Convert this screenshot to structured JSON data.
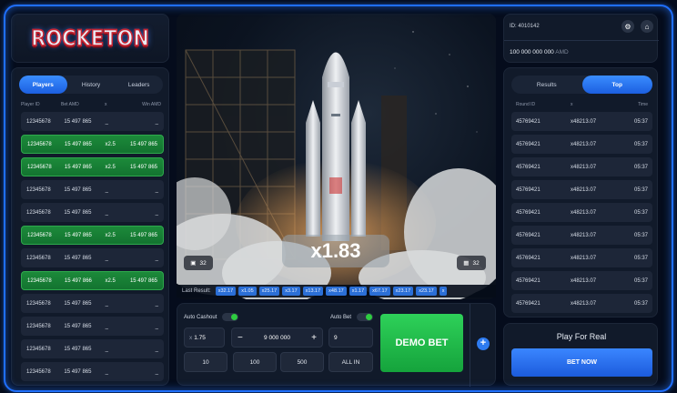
{
  "logo": {
    "text": "ROCKETON"
  },
  "players": {
    "tabs": [
      {
        "label": "Players"
      },
      {
        "label": "History"
      },
      {
        "label": "Leaders"
      }
    ],
    "headers": [
      "Player ID",
      "Bet AMD",
      "x",
      "Win AMD"
    ],
    "rows": [
      {
        "id": "12345678",
        "bet": "15 497 865",
        "x": "_",
        "win": "_",
        "won": false
      },
      {
        "id": "12345678",
        "bet": "15 497 865",
        "x": "x2.5",
        "win": "15 497 865",
        "won": true
      },
      {
        "id": "12345678",
        "bet": "15 497 865",
        "x": "x2.5",
        "win": "15 497 865",
        "won": true
      },
      {
        "id": "12345678",
        "bet": "15 497 865",
        "x": "_",
        "win": "_",
        "won": false
      },
      {
        "id": "12345678",
        "bet": "15 497 865",
        "x": "_",
        "win": "_",
        "won": false
      },
      {
        "id": "12345678",
        "bet": "15 497 865",
        "x": "x2.5",
        "win": "15 497 865",
        "won": true
      },
      {
        "id": "12345678",
        "bet": "15 497 865",
        "x": "_",
        "win": "_",
        "won": false
      },
      {
        "id": "12345678",
        "bet": "15 497 866",
        "x": "x2.5",
        "win": "15 497 865",
        "won": true
      },
      {
        "id": "12345678",
        "bet": "15 497 865",
        "x": "_",
        "win": "_",
        "won": false
      },
      {
        "id": "12345678",
        "bet": "15 497 865",
        "x": "_",
        "win": "_",
        "won": false
      },
      {
        "id": "12345678",
        "bet": "15 497 865",
        "x": "_",
        "win": "_",
        "won": false
      },
      {
        "id": "12345678",
        "bet": "15 497 865",
        "x": "_",
        "win": "_",
        "won": false
      }
    ]
  },
  "game": {
    "multiplier": "x1.83",
    "left_count": "32",
    "right_count": "32",
    "last_result_label": "Last Result:",
    "last_results": [
      "x32.17",
      "x1.05",
      "x25.17",
      "x3.17",
      "x13.17",
      "x48.17",
      "x1.17",
      "x67.17",
      "x23.17",
      "x23.17",
      "x"
    ]
  },
  "bet": {
    "auto_cashout_label": "Auto Cashout",
    "auto_bet_label": "Auto Bet",
    "cashout_value": "1.75",
    "cashout_prefix": "x",
    "amount": "9 000 000",
    "minus": "−",
    "plus": "+",
    "autobet_value": "9",
    "quick": [
      "10",
      "100",
      "500",
      "ALL IN"
    ],
    "demo_bet_label": "DEMO BET",
    "add_label": "+"
  },
  "account": {
    "id_label": "ID: 4010142",
    "balance": "100 000 000 000",
    "currency": "AMD"
  },
  "results": {
    "tabs": [
      {
        "label": "Results"
      },
      {
        "label": "Top"
      }
    ],
    "headers": [
      "Round ID",
      "x",
      "Time"
    ],
    "rows": [
      {
        "round": "45769421",
        "x": "x48213.07",
        "time": "05:37"
      },
      {
        "round": "45769421",
        "x": "x48213.07",
        "time": "05:37"
      },
      {
        "round": "45769421",
        "x": "x48213.07",
        "time": "05:37"
      },
      {
        "round": "45769421",
        "x": "x48213.07",
        "time": "05:37"
      },
      {
        "round": "45769421",
        "x": "x48213.07",
        "time": "05:37"
      },
      {
        "round": "45769421",
        "x": "x48213.07",
        "time": "05:37"
      },
      {
        "round": "45769421",
        "x": "x48213.07",
        "time": "05:37"
      },
      {
        "round": "45769421",
        "x": "x48213.07",
        "time": "05:37"
      },
      {
        "round": "45769421",
        "x": "x48213.07",
        "time": "05:37"
      }
    ]
  },
  "real": {
    "title": "Play For Real",
    "button": "BET NOW"
  }
}
